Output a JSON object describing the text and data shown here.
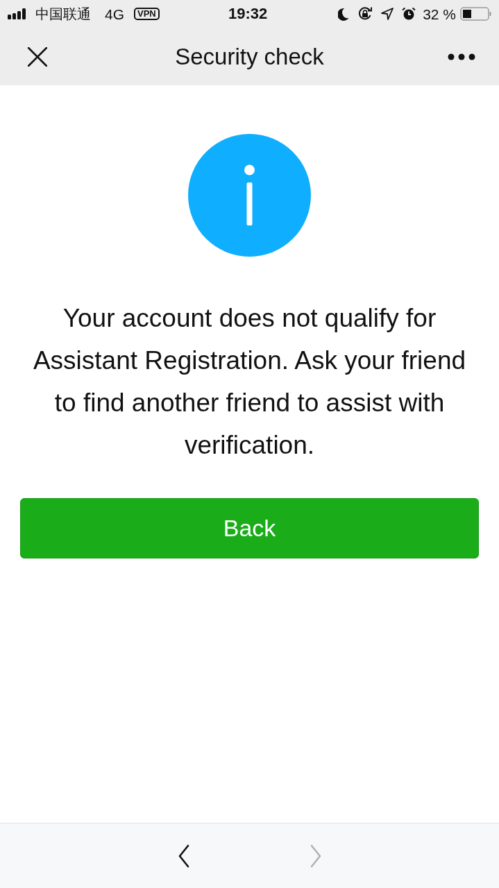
{
  "status_bar": {
    "carrier": "中国联通",
    "network": "4G",
    "vpn": "VPN",
    "time": "19:32",
    "battery_percent": "32 %"
  },
  "header": {
    "title": "Security check"
  },
  "message": "Your account does not qualify for Assistant Registration. Ask your friend to find another friend to assist with verification.",
  "button": {
    "label": "Back"
  },
  "toolbar": {
    "back": {
      "disabled": false
    },
    "forward": {
      "disabled": true
    }
  }
}
